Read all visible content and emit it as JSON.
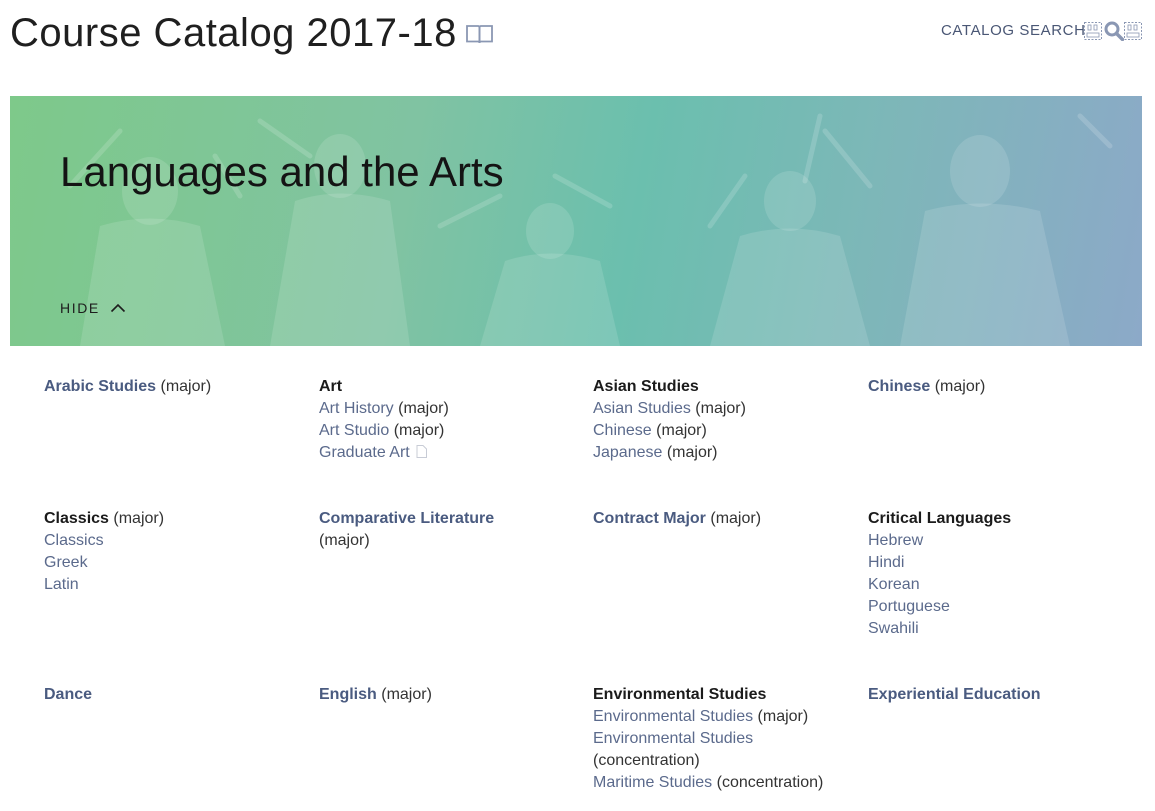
{
  "header": {
    "title": "Course Catalog 2017-18",
    "search_label": "CATALOG SEARCH",
    "icons": [
      "book-icon",
      "separator-icon",
      "search-icon"
    ]
  },
  "banner": {
    "title": "Languages and the Arts",
    "toggle_label": "HIDE"
  },
  "programs": [
    {
      "title": "Arabic Studies",
      "title_link": true,
      "note": "(major)",
      "items": []
    },
    {
      "title": "Art",
      "title_link": false,
      "note": "",
      "items": [
        {
          "label": "Art History",
          "note": "(major)"
        },
        {
          "label": "Art Studio",
          "note": "(major)"
        },
        {
          "label": "Graduate Art",
          "note": "",
          "icon": "document-icon"
        }
      ]
    },
    {
      "title": "Asian Studies",
      "title_link": false,
      "note": "",
      "items": [
        {
          "label": "Asian Studies",
          "note": "(major)"
        },
        {
          "label": "Chinese",
          "note": "(major)"
        },
        {
          "label": "Japanese",
          "note": "(major)"
        }
      ]
    },
    {
      "title": "Chinese",
      "title_link": true,
      "note": "(major)",
      "items": []
    },
    {
      "title": "Classics",
      "title_link": false,
      "note": "(major)",
      "items": [
        {
          "label": "Classics",
          "note": ""
        },
        {
          "label": "Greek",
          "note": ""
        },
        {
          "label": "Latin",
          "note": ""
        }
      ]
    },
    {
      "title": "Comparative Literature",
      "title_link": true,
      "note": "(major)",
      "items": []
    },
    {
      "title": "Contract Major",
      "title_link": true,
      "note": "(major)",
      "items": []
    },
    {
      "title": "Critical Languages",
      "title_link": false,
      "note": "",
      "items": [
        {
          "label": "Hebrew",
          "note": ""
        },
        {
          "label": "Hindi",
          "note": ""
        },
        {
          "label": "Korean",
          "note": ""
        },
        {
          "label": "Portuguese",
          "note": ""
        },
        {
          "label": "Swahili",
          "note": ""
        }
      ]
    },
    {
      "title": "Dance",
      "title_link": true,
      "note": "",
      "items": []
    },
    {
      "title": "English",
      "title_link": true,
      "note": "(major)",
      "items": []
    },
    {
      "title": "Environmental Studies",
      "title_link": false,
      "note": "",
      "items": [
        {
          "label": "Environmental Studies",
          "note": "(major)"
        },
        {
          "label": "Environmental Studies",
          "note": "(concentration)"
        },
        {
          "label": "Maritime Studies",
          "note": "(concentration)"
        }
      ]
    },
    {
      "title": "Experiential Education",
      "title_link": true,
      "note": "",
      "items": []
    }
  ],
  "colors": {
    "link": "#4a5b80",
    "sublink": "#5b6a8c",
    "banner_gradient_start": "#7ec98a",
    "banner_gradient_end": "#8ca9c8"
  }
}
